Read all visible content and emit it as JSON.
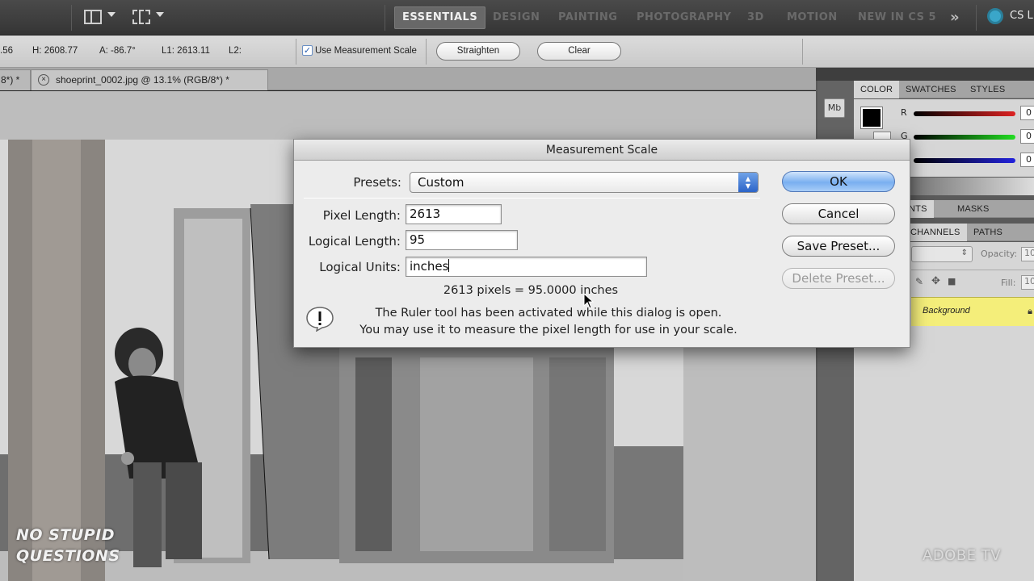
{
  "app_bar": {
    "workspaces": [
      "ESSENTIALS",
      "DESIGN",
      "PAINTING",
      "PHOTOGRAPHY",
      "3D",
      "MOTION",
      "NEW IN CS 5"
    ],
    "more": "»",
    "cs_live": "CS L"
  },
  "options_bar": {
    "w_partial": ".56",
    "h": "H: 2608.77",
    "a": "A: -86.7°",
    "l1": "L1: 2613.11",
    "l2": "L2:",
    "use_measurement_scale_label": "Use Measurement Scale",
    "use_measurement_scale_checked": true,
    "straighten_label": "Straighten",
    "clear_label": "Clear"
  },
  "tabs": [
    {
      "label": "8*) *",
      "close": ""
    },
    {
      "label": "shoeprint_0002.jpg @ 13.1% (RGB/8*) *",
      "close": "×"
    }
  ],
  "panels": {
    "strip_icon": "Mb",
    "color_tabs": [
      "COLOR",
      "SWATCHES",
      "STYLES"
    ],
    "sliders": [
      {
        "name": "R",
        "value": "0",
        "color": "#c42a2a"
      },
      {
        "name": "G",
        "value": "0",
        "color": "#2ec62e"
      },
      {
        "name": "B",
        "value": "0",
        "color": "#2a3ec4"
      }
    ],
    "adjust_tabs": [
      "NTS",
      "MASKS"
    ],
    "layer_tabs": [
      "CHANNELS",
      "PATHS"
    ],
    "opacity_label": "Opacity:",
    "opacity_value": "10",
    "fill_label": "Fill:",
    "fill_value": "10",
    "layer_name": "Background"
  },
  "dialog": {
    "title": "Measurement Scale",
    "presets_label": "Presets:",
    "presets_value": "Custom",
    "pixel_length_label": "Pixel Length:",
    "pixel_length_value": "2613",
    "logical_length_label": "Logical Length:",
    "logical_length_value": "95",
    "logical_units_label": "Logical Units:",
    "logical_units_value": "inches",
    "equivalence": "2613 pixels = 95.0000 inches",
    "info_line1": "The Ruler tool has been activated while this dialog is open.",
    "info_line2": "You may use it to measure the pixel length for use in your scale.",
    "ok_label": "OK",
    "cancel_label": "Cancel",
    "save_preset_label": "Save Preset...",
    "delete_preset_label": "Delete Preset..."
  },
  "watermarks": {
    "left_line1": "NO STUPID",
    "left_line2": "QUESTIONS",
    "right": "ADOBE TV"
  },
  "colors": {
    "accent_blue": "#2c64c8",
    "layer_highlight": "#f4ee7a"
  }
}
